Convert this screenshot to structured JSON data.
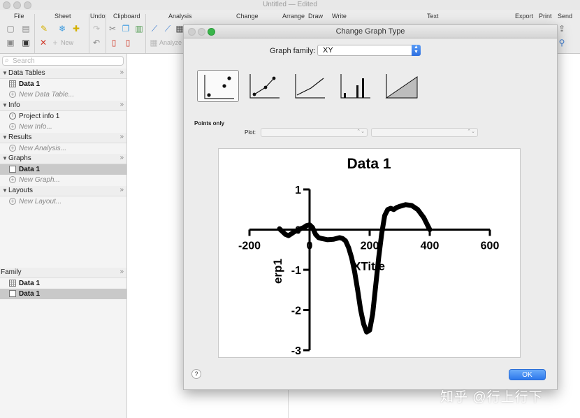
{
  "window": {
    "title": "Untitled",
    "status": "— Edited"
  },
  "toolbar": {
    "groups": [
      "File",
      "Sheet",
      "Undo",
      "Clipboard",
      "Analysis",
      "Change",
      "Arrange",
      "Draw",
      "Write",
      "Text",
      "Export",
      "Print",
      "Send"
    ],
    "new_label": "New",
    "analyze_label": "Analyze"
  },
  "sidebar": {
    "search_placeholder": "Search",
    "sections": [
      {
        "label": "Data Tables",
        "items": [
          {
            "label": "Data 1",
            "kind": "table",
            "bold": true
          },
          {
            "label": "New Data Table...",
            "kind": "new"
          }
        ]
      },
      {
        "label": "Info",
        "items": [
          {
            "label": "Project info 1",
            "kind": "info"
          },
          {
            "label": "New Info...",
            "kind": "new"
          }
        ]
      },
      {
        "label": "Results",
        "items": [
          {
            "label": "New Analysis...",
            "kind": "new"
          }
        ]
      },
      {
        "label": "Graphs",
        "items": [
          {
            "label": "Data 1",
            "kind": "graph",
            "bold": true,
            "selected": true
          },
          {
            "label": "New Graph...",
            "kind": "new"
          }
        ]
      },
      {
        "label": "Layouts",
        "items": [
          {
            "label": "New Layout...",
            "kind": "new"
          }
        ]
      }
    ],
    "family": {
      "label": "Family",
      "items": [
        {
          "label": "Data 1",
          "kind": "table"
        },
        {
          "label": "Data 1",
          "kind": "graph",
          "selected": true
        }
      ]
    }
  },
  "dialog": {
    "title": "Change Graph Type",
    "graph_family_label": "Graph family:",
    "graph_family_value": "XY",
    "graph_types": [
      "points-only",
      "points-and-connecting-line",
      "line-only",
      "spikes",
      "area-fill"
    ],
    "selected_type": "points-only",
    "subtype_title": "Points only",
    "plot_label": "Plot:",
    "help_label": "?",
    "ok_label": "OK"
  },
  "chart_data": {
    "type": "line",
    "title": "Data 1",
    "xlabel": "XTitle",
    "ylabel": "erp1",
    "xlim": [
      -200,
      600
    ],
    "ylim": [
      -3,
      1
    ],
    "xticks": [
      -200,
      0,
      200,
      400,
      600
    ],
    "xtick_labels": [
      "-200",
      "0",
      "200",
      "400",
      "600"
    ],
    "yticks": [
      1,
      0,
      -1,
      -2,
      -3
    ],
    "ytick_labels": [
      "1",
      "0",
      "-1",
      "-2",
      "-3"
    ],
    "grid": false,
    "series": [
      {
        "color": "#000000",
        "x": [
          -100,
          -90,
          -80,
          -70,
          -60,
          -50,
          -40,
          -30,
          -20,
          -10,
          0,
          10,
          20,
          30,
          40,
          60,
          80,
          100,
          110,
          120,
          130,
          140,
          150,
          160,
          170,
          180,
          190,
          200,
          210,
          220,
          230,
          240,
          250,
          260,
          270,
          280,
          290,
          300,
          320,
          340,
          360,
          380,
          390,
          400
        ],
        "y": [
          0.02,
          -0.05,
          -0.12,
          -0.15,
          -0.1,
          -0.05,
          -0.02,
          0.02,
          0.05,
          0.1,
          0.12,
          0.05,
          -0.12,
          -0.2,
          -0.22,
          -0.25,
          -0.24,
          -0.2,
          -0.22,
          -0.28,
          -0.45,
          -0.7,
          -1.05,
          -1.5,
          -2.0,
          -2.35,
          -2.55,
          -2.5,
          -2.1,
          -1.4,
          -0.7,
          -0.1,
          0.35,
          0.5,
          0.53,
          0.5,
          0.55,
          0.58,
          0.62,
          0.6,
          0.5,
          0.3,
          0.15,
          0.0
        ]
      }
    ]
  },
  "watermark": "知乎 @行上行下"
}
